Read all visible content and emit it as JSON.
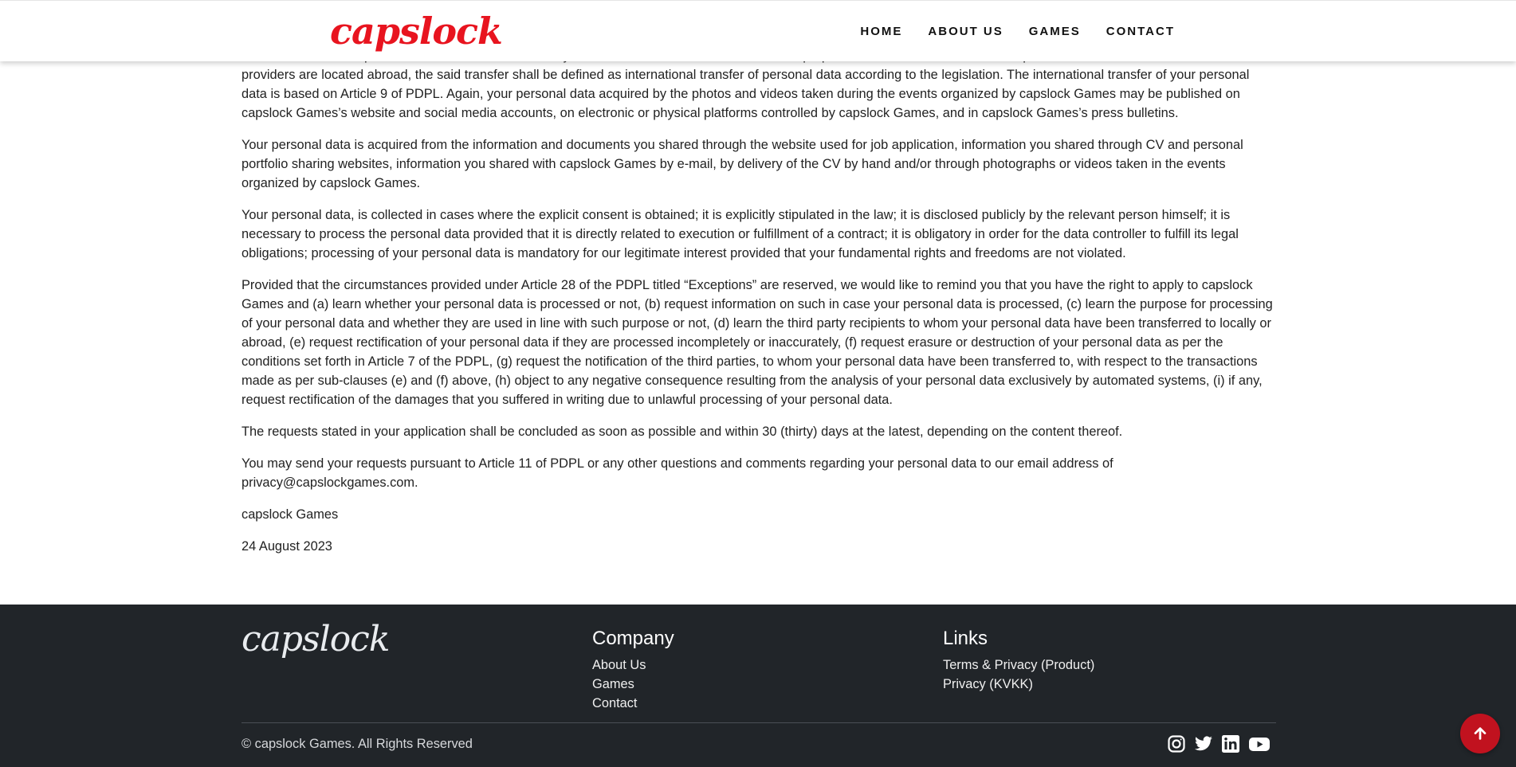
{
  "header": {
    "logo": "capslock",
    "nav": [
      "HOME",
      "ABOUT US",
      "GAMES",
      "CONTACT"
    ]
  },
  "content": {
    "paragraphs": [
      "from or we are in cooperation with in order for us to carry on our activities for the aforementioned purposes. In cases where our service providers and/or the servers of our service providers are located abroad, the said transfer shall be defined as international transfer of personal data according to the legislation. The international transfer of your personal data is based on Article 9 of PDPL. Again, your personal data acquired by the photos and videos taken during the events organized by capslock Games may be published on capslock Games’s website and social media accounts, on electronic or physical platforms controlled by capslock Games, and in capslock Games’s press bulletins.",
      "Your personal data is acquired from the information and documents you shared through the website used for job application, information you shared through CV and personal portfolio sharing websites, information you shared with capslock Games by e-mail, by delivery of the CV by hand and/or through photographs or videos taken in the events organized by capslock Games.",
      "Your personal data, is collected in cases where the explicit consent is obtained; it is explicitly stipulated in the law; it is disclosed publicly by the relevant person himself; it is necessary to process the personal data provided that it is directly related to execution or fulfillment of a contract; it is obligatory in order for the data controller to fulfill its legal obligations; processing of your personal data is mandatory for our legitimate interest provided that your fundamental rights and freedoms are not violated.",
      "Provided that the circumstances provided under Article 28 of the PDPL titled “Exceptions” are reserved, we would like to remind you that you have the right to apply to capslock Games and (a) learn whether your personal data is processed or not, (b) request information on such in case your personal data is processed, (c) learn the purpose for processing of your personal data and whether they are used in line with such purpose or not, (d) learn the third party recipients to whom your personal data have been transferred to locally or abroad, (e) request rectification of your personal data if they are processed incompletely or inaccurately, (f) request erasure or destruction of your personal data as per the conditions set forth in Article 7 of the PDPL, (g) request the notification of the third parties, to whom your personal data have been transferred to, with respect to the transactions made as per sub-clauses (e) and (f) above, (h) object to any negative consequence resulting from the analysis of your personal data exclusively by automated systems, (i) if any, request rectification of the damages that you suffered in writing due to unlawful processing of your personal data.",
      "The requests stated in your application shall be concluded as soon as possible and within 30 (thirty) days at the latest, depending on the content thereof.",
      "You may send your requests pursuant to Article 11 of PDPL or any other questions and comments regarding your personal data to our email address of privacy@capslockgames.com.",
      "capslock Games",
      "24 August 2023"
    ]
  },
  "footer": {
    "logo": "capslock",
    "company_title": "Company",
    "company_links": [
      "About Us",
      "Games",
      "Contact"
    ],
    "links_title": "Links",
    "links": [
      "Terms & Privacy (Product)",
      "Privacy (KVKK)"
    ],
    "copyright": "© capslock Games. All Rights Reserved",
    "socials": [
      "instagram-icon",
      "twitter-icon",
      "linkedin-icon",
      "youtube-icon"
    ]
  },
  "colors": {
    "brand_red": "#e8141f",
    "footer_bg": "#212529",
    "scroll_button": "#c1121f"
  }
}
